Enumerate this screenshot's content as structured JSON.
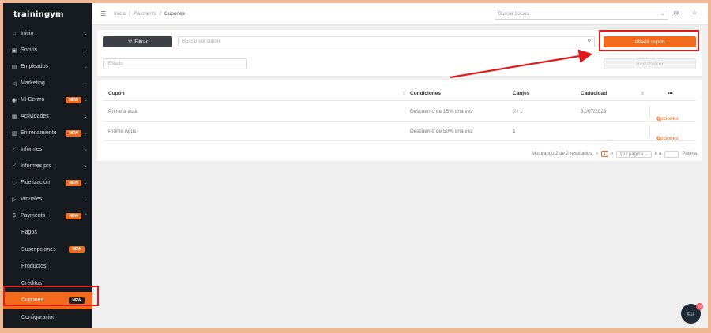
{
  "brand": {
    "logo_text": "trainingym"
  },
  "sidebar": {
    "items": [
      {
        "icon": "home-icon",
        "glyph": "⌂",
        "label": "Inicio",
        "badge": ""
      },
      {
        "icon": "members-icon",
        "glyph": "▣",
        "label": "Socios",
        "badge": ""
      },
      {
        "icon": "staff-icon",
        "glyph": "▤",
        "label": "Empleados",
        "badge": ""
      },
      {
        "icon": "marketing-icon",
        "glyph": "◁",
        "label": "Marketing",
        "badge": ""
      },
      {
        "icon": "location-icon",
        "glyph": "◉",
        "label": "Mi Centro",
        "badge": "NEW"
      },
      {
        "icon": "calendar-icon",
        "glyph": "▦",
        "label": "Actividades",
        "badge": ""
      },
      {
        "icon": "training-icon",
        "glyph": "▥",
        "label": "Entrenamiento",
        "badge": "NEW"
      },
      {
        "icon": "reports-icon",
        "glyph": "⟋",
        "label": "Informes",
        "badge": ""
      },
      {
        "icon": "reports-pro-icon",
        "glyph": "⟋",
        "label": "Informes pro",
        "badge": ""
      },
      {
        "icon": "heart-icon",
        "glyph": "♡",
        "label": "Fidelización",
        "badge": "NEW"
      },
      {
        "icon": "virtual-icon",
        "glyph": "▷",
        "label": "Virtuales",
        "badge": ""
      },
      {
        "icon": "payments-icon",
        "glyph": "$",
        "label": "Payments",
        "badge": "NEW"
      }
    ],
    "payments_sub": [
      {
        "label": "Pagos",
        "badge": ""
      },
      {
        "label": "Suscripciones",
        "badge": "NEW"
      },
      {
        "label": "Productos",
        "badge": ""
      },
      {
        "label": "Créditos",
        "badge": ""
      },
      {
        "label": "Cupones",
        "badge": "NEW"
      },
      {
        "label": "Configuración",
        "badge": ""
      }
    ]
  },
  "topbar": {
    "breadcrumb": [
      "Inicio",
      "Payments",
      "Cupones"
    ],
    "search_placeholder": "Buscar Socios"
  },
  "filters": {
    "filter_button": "Filtrar",
    "search_placeholder": "Buscar por cupón",
    "add_button": "Añadir cupón",
    "estado_placeholder": "Estado",
    "reset_button": "Restablecer"
  },
  "table": {
    "headers": [
      "Cupón",
      "Condiciones",
      "Canjes",
      "Caducidad",
      "•••"
    ],
    "rows": [
      {
        "cupon": "Primera aula",
        "condiciones": "Descuento de 15% una vez",
        "canjes": "0 / 1",
        "caducidad": "31/07/2023",
        "action": "Opciones"
      },
      {
        "cupon": "Promo Agus",
        "condiciones": "Descuento de 50% una vez",
        "canjes": "1",
        "caducidad": "",
        "action": "Opciones"
      }
    ]
  },
  "pagination": {
    "summary": "Mostrando 2 de 2 resultados.",
    "current_page": "1",
    "per_page": "10 / página",
    "goto_label": "Ir a",
    "page_label": "Página"
  },
  "chat": {
    "badge": "15"
  },
  "colors": {
    "accent": "#f26a1c",
    "sidebar": "#161b22",
    "highlight": "#e01b1b"
  }
}
